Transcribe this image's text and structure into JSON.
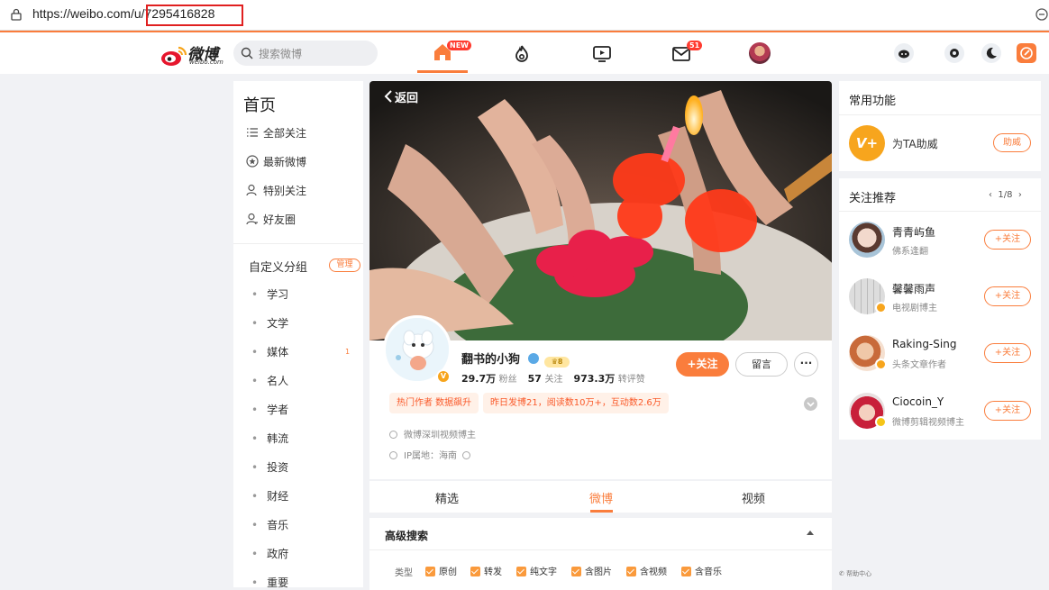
{
  "browser": {
    "url_prefix": "https://weibo.com/u/",
    "url_highlight": "7295416828"
  },
  "nav": {
    "logo_cn": "微博",
    "logo_en": "weibo.com",
    "search_placeholder": "搜索微博",
    "home_badge": "NEW",
    "msg_badge": "51",
    "icons": [
      "home-icon",
      "hot-icon",
      "video-icon",
      "mail-icon",
      "user-avatar",
      "game-icon",
      "settings-icon",
      "theme-icon",
      "edit-icon"
    ]
  },
  "left_nav": {
    "title": "首页",
    "items": [
      {
        "label": "全部关注",
        "icon": "list-icon"
      },
      {
        "label": "最新微博",
        "icon": "star-circle-icon"
      },
      {
        "label": "特别关注",
        "icon": "user-special-icon"
      },
      {
        "label": "好友圈",
        "icon": "user-friends-icon"
      }
    ],
    "group_title": "自定义分组",
    "manage_label": "管理",
    "groups": [
      "学习",
      "文学",
      "媒体",
      "名人",
      "学者",
      "韩流",
      "投资",
      "财经",
      "音乐",
      "政府",
      "重要"
    ],
    "group_badge": "1"
  },
  "profile": {
    "back_label": "返回",
    "name": "翻书的小狗",
    "followers_num": "29.7万",
    "followers_label": "粉丝",
    "following_num": "57",
    "following_label": "关注",
    "engage_num": "973.3万",
    "engage_label": "转评赞",
    "follow_label": "+关注",
    "message_label": "留言",
    "more_label": "···",
    "tags": [
      "热门作者 数据飙升",
      "昨日发博21，阅读数10万+，互动数2.6万"
    ],
    "verify_text": "微博深圳视频博主",
    "ip_text": "IP属地：海南",
    "level_badge": "8"
  },
  "tabs": [
    "精选",
    "微博",
    "视频"
  ],
  "active_tab": "微博",
  "advanced_search": {
    "title": "高级搜索",
    "type_label": "类型",
    "options": [
      "原创",
      "转发",
      "纯文字",
      "含图片",
      "含视频",
      "含音乐"
    ]
  },
  "right": {
    "common_title": "常用功能",
    "helper_label": "为TA助威",
    "helper_button": "助威",
    "rec_title": "关注推荐",
    "pager": "1/8",
    "recommendations": [
      {
        "name": "青青屿鱼",
        "desc": "佛系逢翻",
        "follow": "+关注"
      },
      {
        "name": "馨馨雨声",
        "desc": "电视剧博主",
        "follow": "+关注"
      },
      {
        "name": "Raking-Sing",
        "desc": "头条文章作者",
        "follow": "+关注"
      },
      {
        "name": "Ciocoin_Y",
        "desc": "微博剪辑视频博主",
        "follow": "+关注"
      }
    ],
    "help_label": "帮助中心"
  },
  "colors": {
    "accent": "#fa7d3c",
    "badge_red": "#ff3b30",
    "verified": "#f7a51d"
  }
}
